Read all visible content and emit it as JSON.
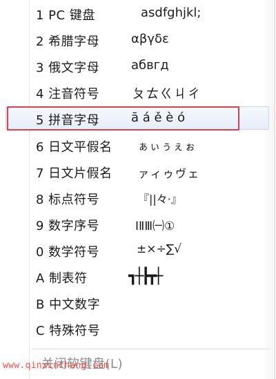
{
  "menu": {
    "items": [
      {
        "label": "1 PC 键盘",
        "sample": "asdfghjkl;"
      },
      {
        "label": "2 希腊字母",
        "sample": "αβγδε"
      },
      {
        "label": "3 俄文字母",
        "sample": "абвгд"
      },
      {
        "label": "4 注音符号",
        "sample": "ㄆㄊㄍㄐㄔ"
      },
      {
        "label": "5 拼音字母",
        "sample": "ā á ě è ó"
      },
      {
        "label": "6 日文平假名",
        "sample": "ぁぃぅぇぉ"
      },
      {
        "label": "7 日文片假名",
        "sample": "ァィゥヴェ"
      },
      {
        "label": "8 标点符号",
        "sample": "『||々·』"
      },
      {
        "label": "9 数字序号",
        "sample": "ⅠⅡⅢ㈠①"
      },
      {
        "label": "0 数学符号",
        "sample": "±×÷∑√"
      },
      {
        "label": "A 制表符",
        "sample": "┓┼┣┳┼"
      },
      {
        "label": "B 中文数字",
        "sample": ""
      },
      {
        "label": "C 特殊符号",
        "sample": ""
      }
    ],
    "close_label": "关闭软键盘(L)",
    "highlighted_index": 4
  },
  "watermark": "www.qinxinchang.com",
  "colors": {
    "highlight_border": "#e0404c",
    "hover_fill": "#e7eefa",
    "text": "#1b1b1b",
    "disabled_text": "#8a8a8a"
  }
}
